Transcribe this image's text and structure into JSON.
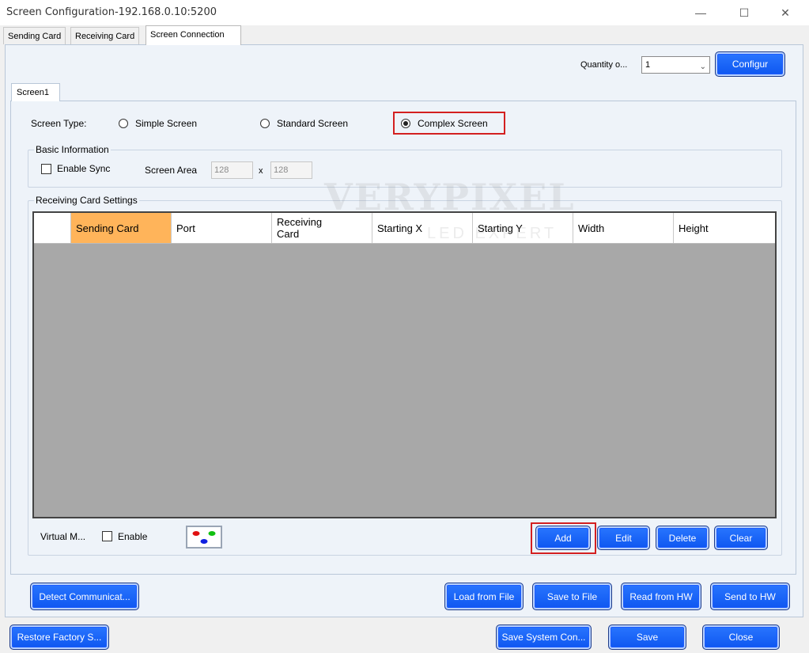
{
  "window": {
    "title": "Screen Configuration-192.168.0.10:5200",
    "minimize": "—",
    "maximize": "☐",
    "close": "✕"
  },
  "tabs": [
    {
      "label": "Sending Card"
    },
    {
      "label": "Receiving Card"
    },
    {
      "label": "Screen Connection"
    }
  ],
  "quantity": {
    "label": "Quantity o...",
    "value": "1",
    "arrow": "⌄"
  },
  "buttons": {
    "configure": "Configur",
    "add": "Add",
    "edit": "Edit",
    "delete": "Delete",
    "clear": "Clear",
    "detect_communication": "Detect Communicat...",
    "load_from_file": "Load from File",
    "save_to_file": "Save to File",
    "read_from_hw": "Read from HW",
    "send_to_hw": "Send to HW",
    "restore_factory": "Restore Factory S...",
    "save_system_config": "Save System Con...",
    "save": "Save",
    "close": "Close"
  },
  "screen_tab": "Screen1",
  "screen_type": {
    "label": "Screen Type:",
    "options": [
      "Simple Screen",
      "Standard Screen",
      "Complex Screen"
    ],
    "selected": "Complex Screen"
  },
  "basic_info": {
    "title": "Basic Information",
    "enable_sync": "Enable Sync",
    "screen_area_label": "Screen Area",
    "width": "128",
    "separator": "x",
    "height": "128"
  },
  "receiving_settings": {
    "title": "Receiving Card Settings",
    "columns": [
      "",
      "Sending Card",
      "Port",
      "Receiving Card",
      "Starting X",
      "Starting Y",
      "Width",
      "Height"
    ]
  },
  "virtual": {
    "label": "Virtual M...",
    "enable": "Enable"
  },
  "watermark": {
    "main": "VERYPIXEL",
    "sub": "LED EXPERT"
  }
}
